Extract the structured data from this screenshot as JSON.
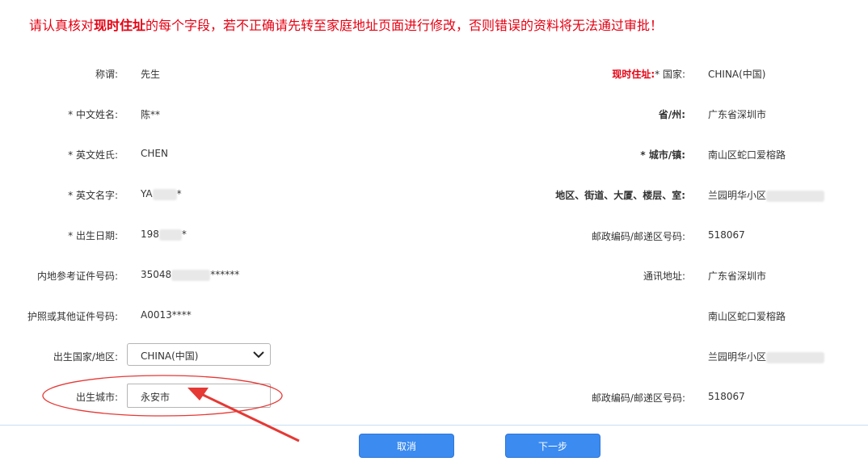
{
  "notice": {
    "prefix": "请认真核对",
    "highlight": "现时住址",
    "suffix": "的每个字段，若不正确请先转至家庭地址页面进行修改，否则错误的资料将无法通过审批！"
  },
  "left": {
    "title": {
      "label": "称谓:",
      "value": "先生"
    },
    "chinese_name": {
      "req": "* ",
      "label": "中文姓名:",
      "value": "陈**"
    },
    "english_surname": {
      "req": "* ",
      "label": "英文姓氏:",
      "value": "CHEN"
    },
    "english_given": {
      "req": "* ",
      "label": "英文名字:",
      "value_prefix": "YA",
      "value_suffix": "*"
    },
    "birth_date": {
      "req": "* ",
      "label": "出生日期:",
      "value_prefix": "198",
      "value_suffix": "*"
    },
    "mainland_id": {
      "label": "内地参考证件号码:",
      "value_prefix": "35048",
      "value_suffix": "******"
    },
    "passport": {
      "label": "护照或其他证件号码:",
      "value": "A0013****"
    },
    "birth_country": {
      "label": "出生国家/地区:",
      "selected": "CHINA(中国)"
    },
    "birth_city": {
      "label": "出生城市:",
      "value": "永安市"
    }
  },
  "right": {
    "current_address_label": "现时住址:",
    "country": {
      "req": "* ",
      "label": "国家:",
      "value": "CHINA(中国)"
    },
    "province": {
      "label": "省/州:",
      "value": "广东省深圳市"
    },
    "city": {
      "req": "* ",
      "label": "城市/镇:",
      "value": "南山区蛇口爱榕路"
    },
    "district": {
      "label": "地区、街道、大厦、楼层、室:",
      "value_prefix": "兰园明华小区"
    },
    "postcode": {
      "label": "邮政编码/邮递区号码:",
      "value": "518067"
    },
    "mailing": {
      "label": "通讯地址:",
      "line1": "广东省深圳市",
      "line2": "南山区蛇口爱榕路",
      "line3_prefix": "兰园明华小区"
    },
    "mailing_postcode": {
      "label": "邮政编码/邮递区号码:",
      "value": "518067"
    }
  },
  "buttons": {
    "cancel": "取消",
    "next": "下一步"
  },
  "colors": {
    "notice": "#e60012",
    "button": "#3b8bf0",
    "annotation": "#e53935"
  }
}
